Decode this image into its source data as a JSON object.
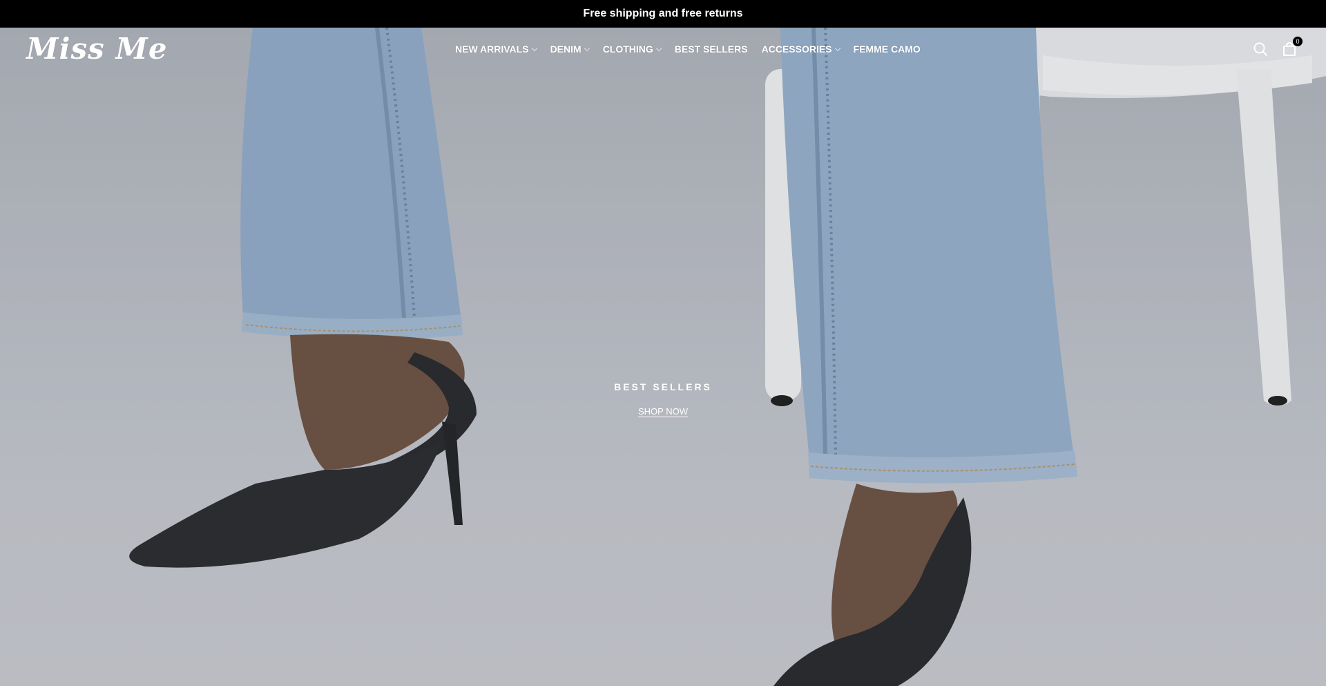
{
  "announcement": {
    "text": "Free shipping and free returns"
  },
  "brand": {
    "logo_text": "Miss Me"
  },
  "nav": {
    "items": [
      {
        "label": "NEW ARRIVALS",
        "has_dropdown": true
      },
      {
        "label": "DENIM",
        "has_dropdown": true
      },
      {
        "label": "CLOTHING",
        "has_dropdown": true
      },
      {
        "label": "BEST SELLERS",
        "has_dropdown": false
      },
      {
        "label": "ACCESSORIES",
        "has_dropdown": true
      },
      {
        "label": "FEMME CAMO",
        "has_dropdown": false
      }
    ]
  },
  "header_icons": {
    "search": "search-icon",
    "cart": "shopping-bag-icon",
    "cart_count": "0"
  },
  "hero": {
    "title": "BEST SELLERS",
    "cta_label": "SHOP NOW",
    "colors": {
      "denim": "#8fa8c4",
      "shoe": "#2b2d31",
      "skin": "#6e5547",
      "chair": "#eeeff1"
    }
  }
}
